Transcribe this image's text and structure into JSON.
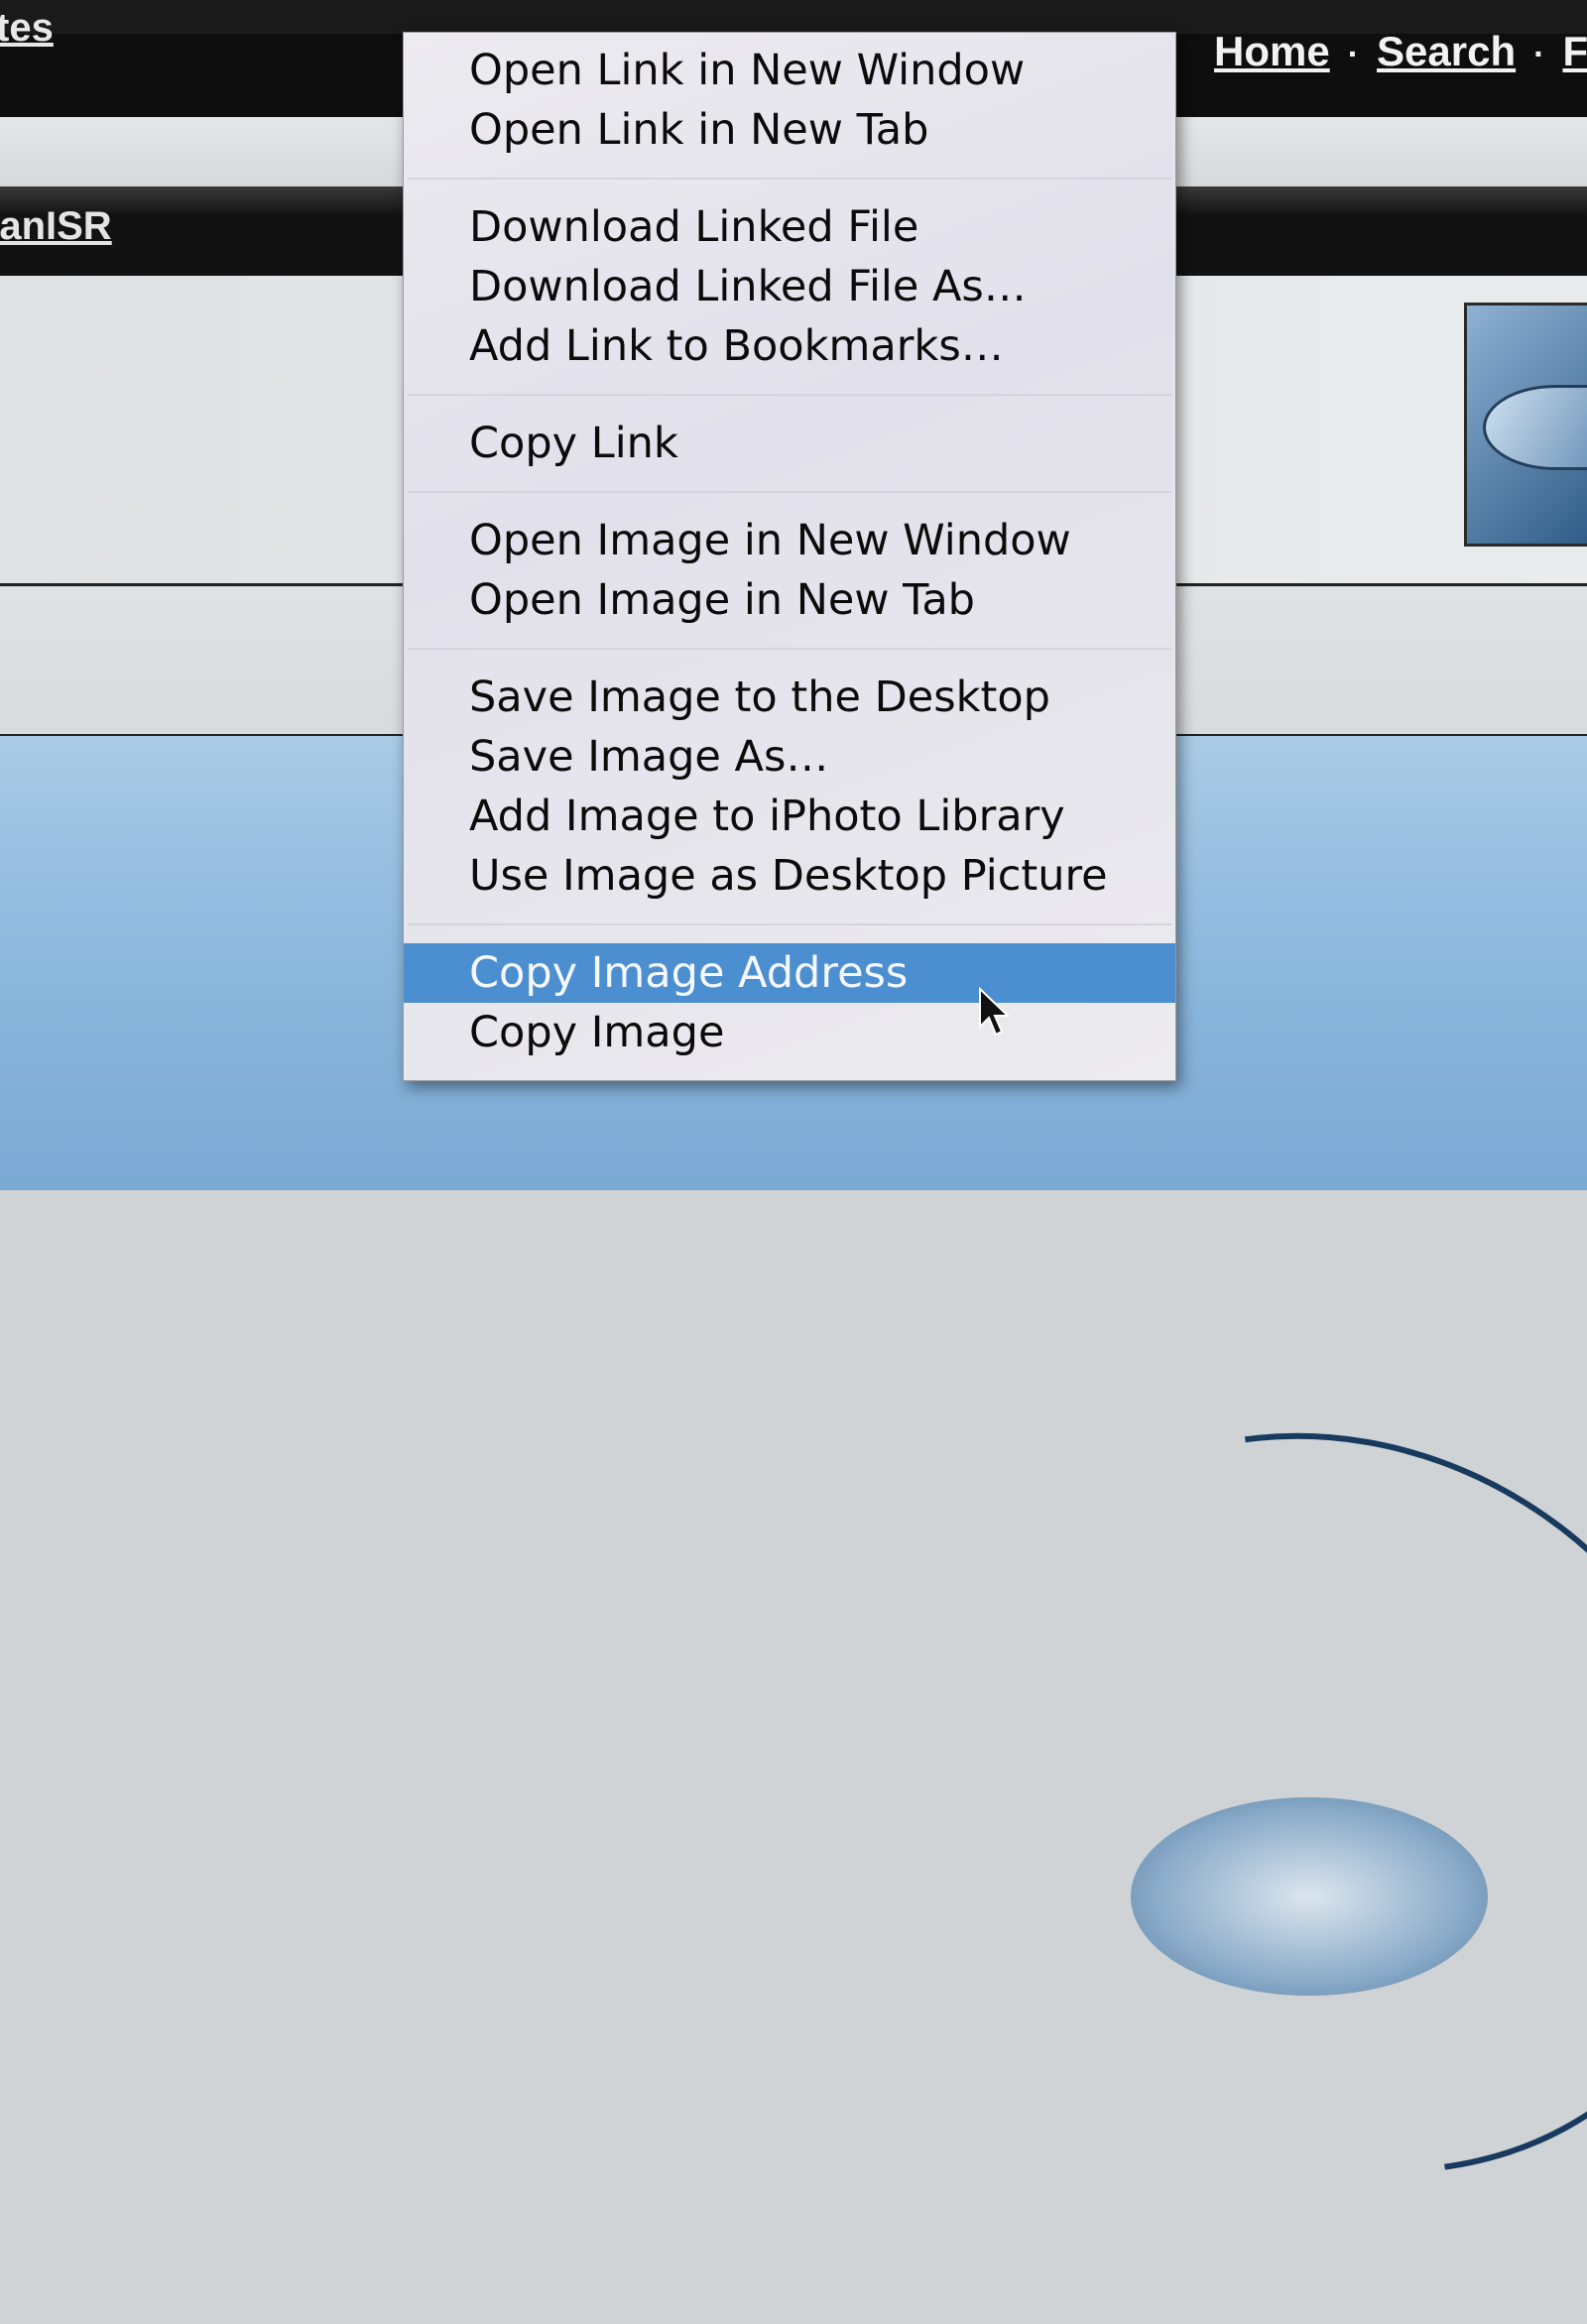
{
  "page": {
    "top_left_link": "tes",
    "nav": {
      "home": "Home",
      "search": "Search",
      "partial": "F",
      "separator": "·"
    },
    "user_link": "tanISR"
  },
  "context_menu": {
    "groups": [
      [
        "Open Link in New Window",
        "Open Link in New Tab"
      ],
      [
        "Download Linked File",
        "Download Linked File As…",
        "Add Link to Bookmarks…"
      ],
      [
        "Copy Link"
      ],
      [
        "Open Image in New Window",
        "Open Image in New Tab"
      ],
      [
        "Save Image to the Desktop",
        "Save Image As…",
        "Add Image to iPhoto Library",
        "Use Image as Desktop Picture"
      ],
      [
        "Copy Image Address",
        "Copy Image"
      ]
    ],
    "highlighted": "Copy Image Address",
    "highlight_color": "#4b8fd0"
  },
  "cursor": {
    "icon": "arrow-cursor-icon"
  }
}
